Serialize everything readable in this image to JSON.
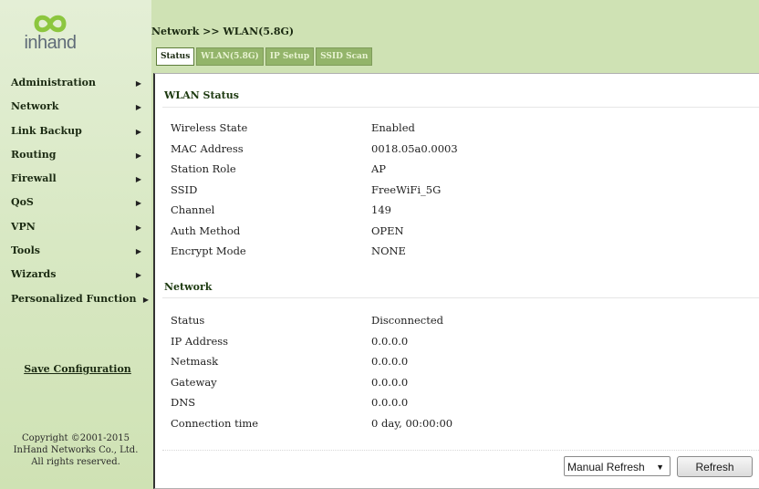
{
  "logo": {
    "brand": "inhand"
  },
  "header": {
    "breadcrumb": "Network >> WLAN(5.8G)",
    "tabs": [
      {
        "label": "Status",
        "active": true
      },
      {
        "label": "WLAN(5.8G)",
        "active": false
      },
      {
        "label": "IP Setup",
        "active": false
      },
      {
        "label": "SSID Scan",
        "active": false
      }
    ]
  },
  "sidebar": {
    "items": [
      {
        "label": "Administration"
      },
      {
        "label": "Network"
      },
      {
        "label": "Link Backup"
      },
      {
        "label": "Routing"
      },
      {
        "label": "Firewall"
      },
      {
        "label": "QoS"
      },
      {
        "label": "VPN"
      },
      {
        "label": "Tools"
      },
      {
        "label": "Wizards"
      },
      {
        "label": "Personalized Function"
      }
    ],
    "arrow": "▶",
    "save_label": "Save Configuration",
    "copyright": [
      "Copyright ©2001-2015",
      "InHand Networks Co., Ltd.",
      "All rights reserved."
    ]
  },
  "wlan_status": {
    "title": "WLAN Status",
    "rows": [
      {
        "label": "Wireless State",
        "value": "Enabled"
      },
      {
        "label": "MAC Address",
        "value": "0018.05a0.0003"
      },
      {
        "label": "Station Role",
        "value": "AP"
      },
      {
        "label": "SSID",
        "value": "FreeWiFi_5G"
      },
      {
        "label": "Channel",
        "value": "149"
      },
      {
        "label": "Auth Method",
        "value": "OPEN"
      },
      {
        "label": "Encrypt Mode",
        "value": "NONE"
      }
    ]
  },
  "network": {
    "title": "Network",
    "rows": [
      {
        "label": "Status",
        "value": "Disconnected"
      },
      {
        "label": "IP Address",
        "value": "0.0.0.0"
      },
      {
        "label": "Netmask",
        "value": "0.0.0.0"
      },
      {
        "label": "Gateway",
        "value": "0.0.0.0"
      },
      {
        "label": "DNS",
        "value": "0.0.0.0"
      },
      {
        "label": "Connection time",
        "value": "0 day, 00:00:00"
      }
    ]
  },
  "footer": {
    "refresh_mode": "Manual Refresh",
    "caret": "▼",
    "refresh_label": "Refresh"
  },
  "colors": {
    "sidebar_bg": "#d8e8c3",
    "accent": "#93b46a",
    "logo_green": "#8cc63f",
    "logo_text": "#5f6b78"
  }
}
